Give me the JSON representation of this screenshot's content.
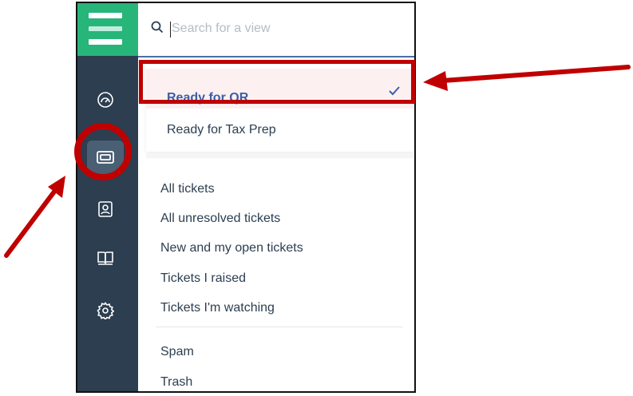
{
  "search": {
    "placeholder": "Search for a view",
    "value": ""
  },
  "sidebar": {
    "items": [
      {
        "icon": "gauge-icon",
        "active": false
      },
      {
        "icon": "ticket-icon",
        "active": true
      },
      {
        "icon": "contact-icon",
        "active": false
      },
      {
        "icon": "book-icon",
        "active": false
      },
      {
        "icon": "gear-icon",
        "active": false
      }
    ]
  },
  "views": {
    "pinned": [
      {
        "label": "Ready for QR",
        "selected": true
      },
      {
        "label": "Ready for Tax Prep",
        "selected": false
      }
    ],
    "default": [
      {
        "label": "All tickets"
      },
      {
        "label": "All unresolved tickets"
      },
      {
        "label": "New and my open tickets"
      },
      {
        "label": "Tickets I raised"
      },
      {
        "label": "Tickets I'm watching"
      }
    ],
    "other": [
      {
        "label": "Spam"
      },
      {
        "label": "Trash"
      }
    ]
  },
  "colors": {
    "sidebar": "#2c3e50",
    "logo": "#27b57a",
    "accent": "#3a5fa8",
    "annotation": "#c00000"
  }
}
